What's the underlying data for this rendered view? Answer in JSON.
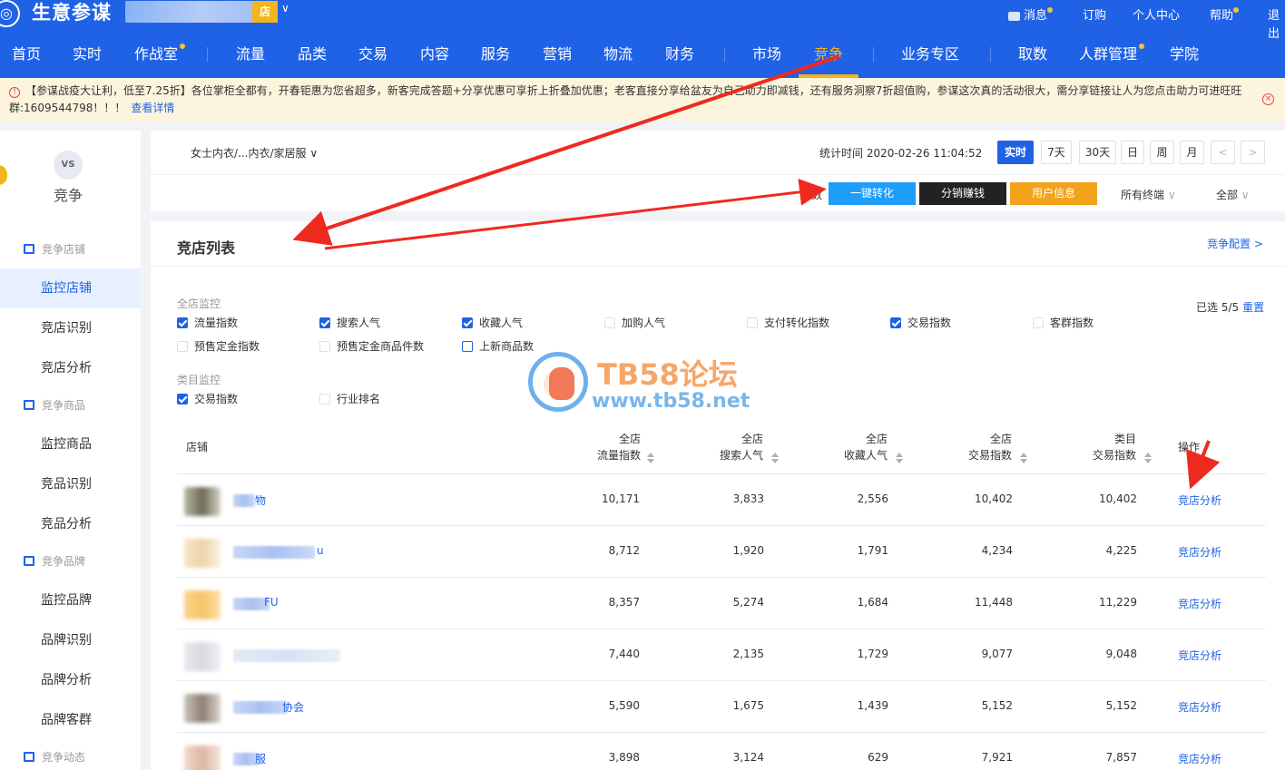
{
  "topbar": {
    "brand": "生意参谋",
    "shop_badge": "店",
    "messages": "消息",
    "orders": "订购",
    "user_center": "个人中心",
    "help": "帮助",
    "logout": "退出"
  },
  "nav": {
    "items": [
      "首页",
      "实时",
      "作战室",
      "流量",
      "品类",
      "交易",
      "内容",
      "服务",
      "营销",
      "物流",
      "财务",
      "市场",
      "竞争",
      "业务专区",
      "取数",
      "人群管理",
      "学院"
    ],
    "active": "竞争"
  },
  "notice": {
    "text": "【参谋战疫大让利，低至7.25折】各位掌柜全都有，开春钜惠为您省超多，新客完成答题+分享优惠可享折上折叠加优惠；老客直接分享给盆友为自己助力即减钱，还有服务洞察7折超值购，参谋这次真的活动很大，需分享链接让人为您点击助力可进旺旺群:1609544798！！！",
    "link": "查看详情"
  },
  "sidebar": {
    "module": "竞争",
    "vs": "VS",
    "sections": [
      {
        "title": "竞争店铺",
        "items": [
          "监控店铺",
          "竞店识别",
          "竞店分析"
        ]
      },
      {
        "title": "竞争商品",
        "items": [
          "监控商品",
          "竞品识别",
          "竞品分析"
        ]
      },
      {
        "title": "竞争品牌",
        "items": [
          "监控品牌",
          "品牌识别",
          "品牌分析",
          "品牌客群"
        ]
      },
      {
        "title": "竞争动态",
        "items": []
      }
    ],
    "active": "监控店铺"
  },
  "filter": {
    "category": "女士内衣/...内衣/家居服",
    "stat_time": "统计时间 2020-02-26 11:04:52",
    "time_buttons": [
      "实时",
      "7天",
      "30天",
      "日",
      "周",
      "月"
    ],
    "active_time": "实时",
    "prev": "<",
    "next": ">",
    "actions": [
      "一键转化",
      "分销赚钱",
      "用户信息"
    ],
    "terminal": "所有终端",
    "scope": "全部",
    "partial_label": "数"
  },
  "list": {
    "title": "竞店列表",
    "config": "竞争配置 >",
    "selected": "已选 5/5",
    "reset": "重置",
    "group_shop": "全店监控",
    "group_cat": "类目监控",
    "shop_checks": [
      {
        "label": "流量指数",
        "checked": true
      },
      {
        "label": "搜索人气",
        "checked": true
      },
      {
        "label": "收藏人气",
        "checked": true
      },
      {
        "label": "加购人气",
        "checked": false
      },
      {
        "label": "支付转化指数",
        "checked": false
      },
      {
        "label": "交易指数",
        "checked": true
      },
      {
        "label": "客群指数",
        "checked": false
      },
      {
        "label": "预售定金指数",
        "checked": false
      },
      {
        "label": "预售定金商品件数",
        "checked": false
      },
      {
        "label": "上新商品数",
        "checked": false
      }
    ],
    "cat_checks": [
      {
        "label": "交易指数",
        "checked": true
      },
      {
        "label": "行业排名",
        "checked": false
      }
    ],
    "columns": {
      "shop": "店铺",
      "c1": [
        "全店",
        "流量指数"
      ],
      "c2": [
        "全店",
        "搜索人气"
      ],
      "c3": [
        "全店",
        "收藏人气"
      ],
      "c4": [
        "全店",
        "交易指数"
      ],
      "c5": [
        "类目",
        "交易指数"
      ],
      "op": "操作"
    },
    "op_label": "竞店分析",
    "rows": [
      {
        "name_tail": "物",
        "v": [
          "10,171",
          "3,833",
          "2,556",
          "10,402",
          "10,402"
        ]
      },
      {
        "name_tail": "u",
        "v": [
          "8,712",
          "1,920",
          "1,791",
          "4,234",
          "4,225"
        ]
      },
      {
        "name_tail": "FU",
        "v": [
          "8,357",
          "5,274",
          "1,684",
          "11,448",
          "11,229"
        ]
      },
      {
        "name_tail": "",
        "v": [
          "7,440",
          "2,135",
          "1,729",
          "9,077",
          "9,048"
        ]
      },
      {
        "name_tail": "协会",
        "v": [
          "5,590",
          "1,675",
          "1,439",
          "5,152",
          "5,152"
        ]
      },
      {
        "name_tail": "服",
        "v": [
          "3,898",
          "3,124",
          "629",
          "7,921",
          "7,857"
        ]
      }
    ]
  },
  "watermark": {
    "title": "TB58论坛",
    "url": "www.tb58.net"
  },
  "colors": {
    "primary": "#2062e6",
    "accent": "#f3b51b",
    "annotation": "#ee2a1f"
  }
}
